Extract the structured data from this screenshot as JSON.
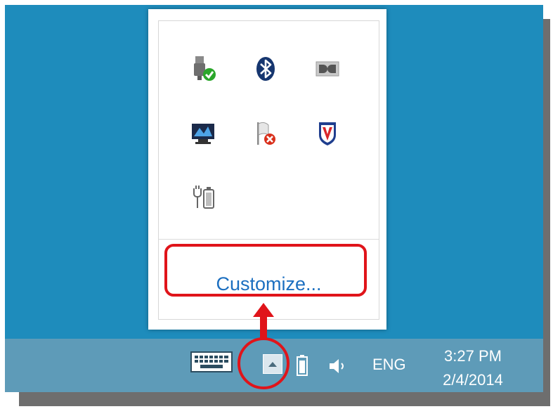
{
  "popup": {
    "customize_label": "Customize...",
    "icons": [
      {
        "name": "usb-safely-remove-icon"
      },
      {
        "name": "bluetooth-icon"
      },
      {
        "name": "dolby-audio-icon"
      },
      {
        "name": "display-settings-icon"
      },
      {
        "name": "action-center-flag-icon"
      },
      {
        "name": "mcafee-shield-icon"
      },
      {
        "name": "power-battery-icon"
      }
    ]
  },
  "taskbar": {
    "language": "ENG",
    "time": "3:27 PM",
    "date": "2/4/2014"
  },
  "colors": {
    "desktop": "#1e8cbc",
    "taskbar": "#5e9bb8",
    "link": "#1c6fc0",
    "highlight": "#e0141a"
  }
}
